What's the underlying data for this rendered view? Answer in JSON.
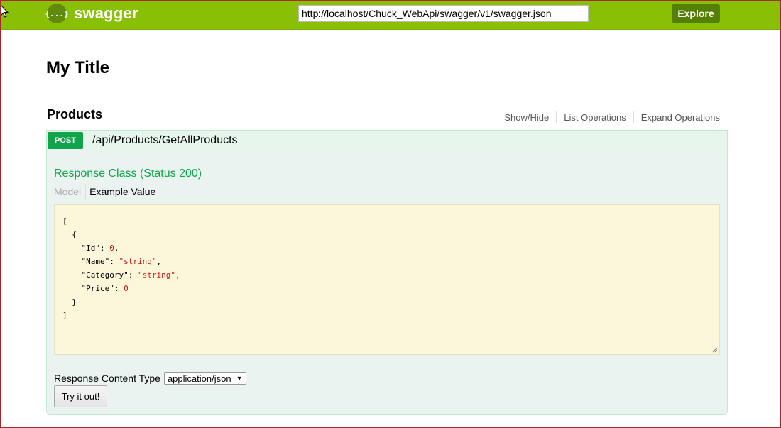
{
  "header": {
    "logo_glyph": "{...}",
    "logo_text": "swagger",
    "url_value": "http://localhost/Chuck_WebApi/swagger/v1/swagger.json",
    "explore_label": "Explore",
    "background_color": "#89bf04"
  },
  "page": {
    "title": "My Title"
  },
  "resource": {
    "name": "Products",
    "links": {
      "show_hide": "Show/Hide",
      "list_operations": "List Operations",
      "expand_operations": "Expand Operations"
    }
  },
  "operation": {
    "method": "POST",
    "method_color": "#10a54a",
    "path": "/api/Products/GetAllProducts",
    "response_class": "Response Class (Status 200)",
    "tabs": {
      "model": "Model",
      "example_value": "Example Value"
    },
    "example": {
      "open": "[",
      "obj_open": "  {",
      "fields": [
        {
          "key": "\"Id\"",
          "value": "0",
          "sep": ","
        },
        {
          "key": "\"Name\"",
          "value": "\"string\"",
          "sep": ","
        },
        {
          "key": "\"Category\"",
          "value": "\"string\"",
          "sep": ","
        },
        {
          "key": "\"Price\"",
          "value": "0",
          "sep": ""
        }
      ],
      "obj_close": "  }",
      "close": "]"
    },
    "content_type_label": "Response Content Type",
    "content_type_value": "application/json",
    "try_label": "Try it out!"
  }
}
